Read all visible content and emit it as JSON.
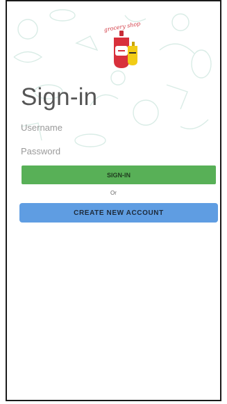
{
  "brand": {
    "logo_text": "grocery shop",
    "logo_icon": "sauce-bottle-logo-icon"
  },
  "page": {
    "title": "Sign-in"
  },
  "form": {
    "username_placeholder": "Username",
    "password_placeholder": "Password",
    "signin_label": "SIGN-IN",
    "or_text": "Or",
    "create_account_label": "CREATE NEW ACCOUNT"
  },
  "colors": {
    "signin_button": "#58b057",
    "create_button": "#5f9de2",
    "doodle": "#d9ece6",
    "title": "#555555"
  }
}
